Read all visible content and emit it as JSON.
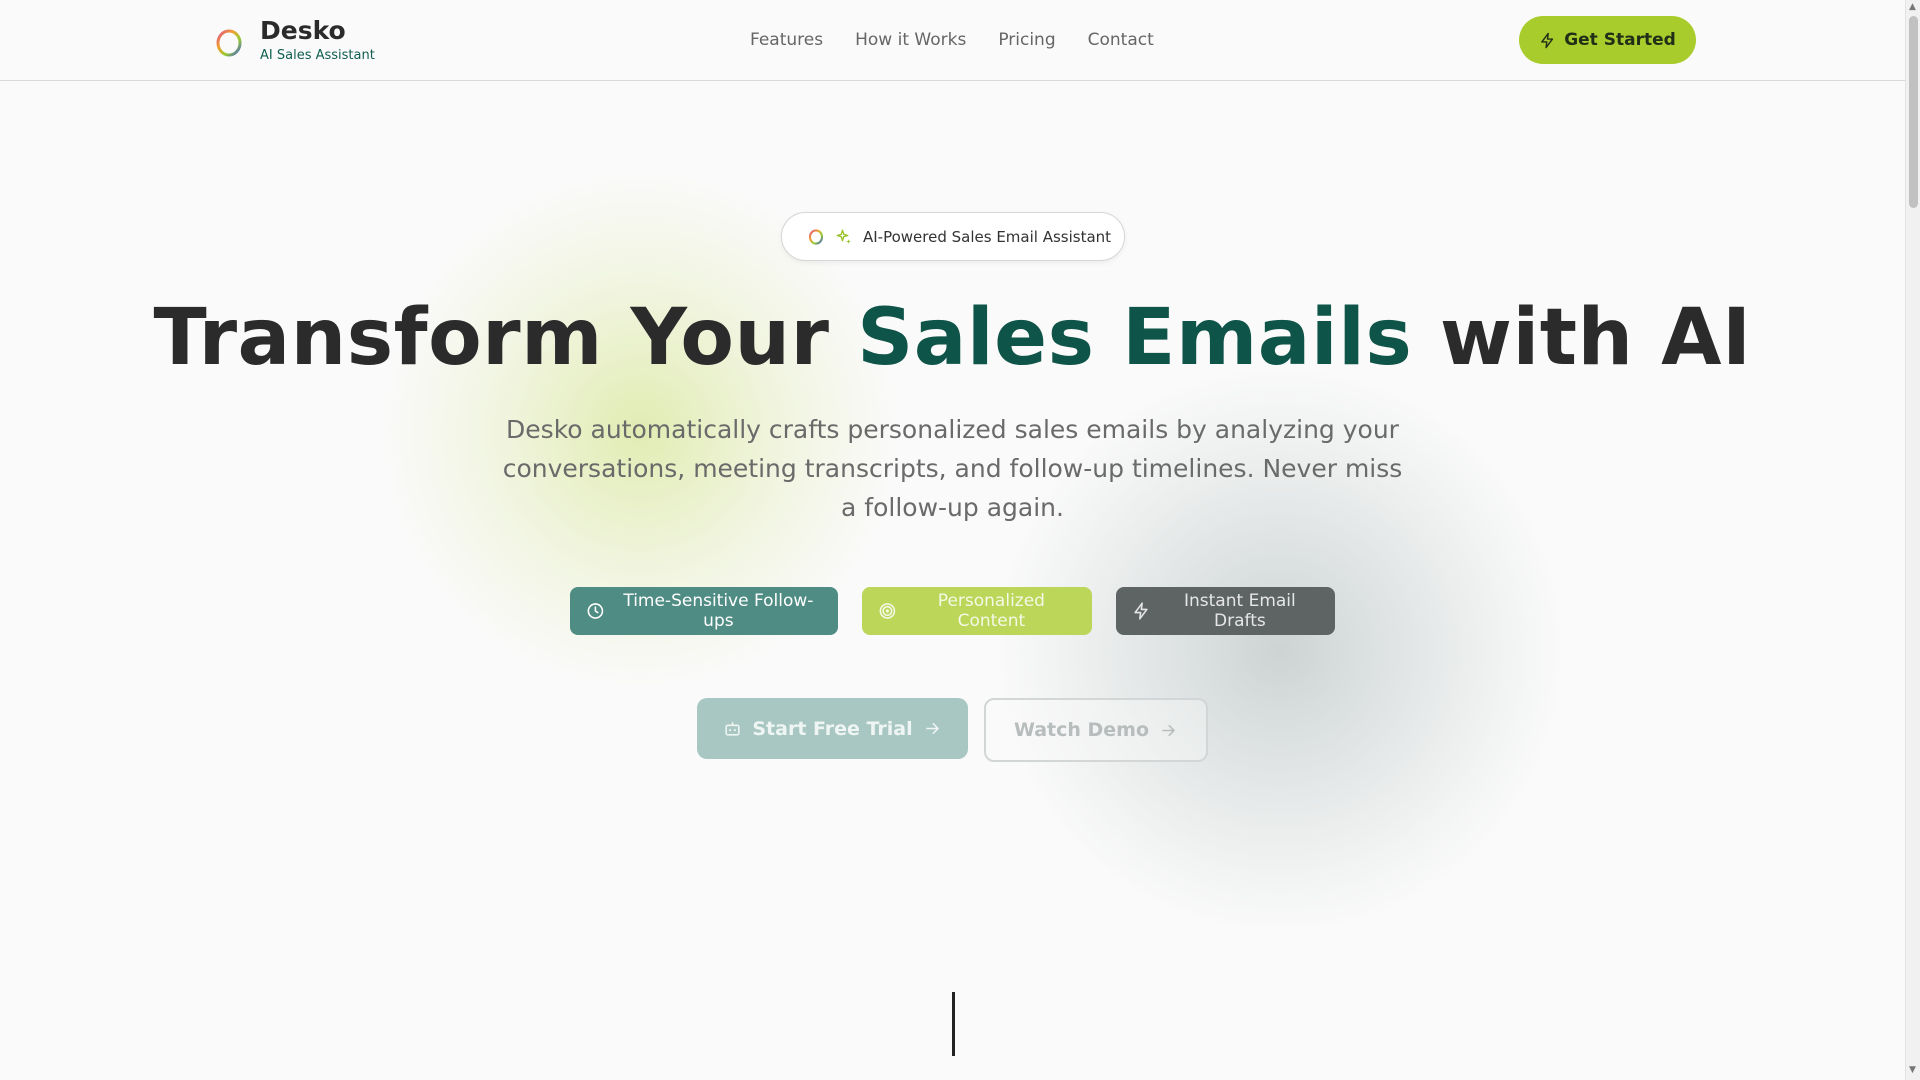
{
  "brand": {
    "name": "Desko",
    "tagline": "AI Sales Assistant"
  },
  "nav": {
    "items": [
      {
        "label": "Features"
      },
      {
        "label": "How it Works"
      },
      {
        "label": "Pricing"
      },
      {
        "label": "Contact"
      }
    ]
  },
  "header": {
    "cta_label": "Get Started"
  },
  "hero": {
    "pill_text": "AI-Powered Sales Email Assistant",
    "headline_part1": "Transform Your ",
    "headline_accent": "Sales Emails",
    "headline_part2": " with AI",
    "description": "Desko automatically crafts personalized sales emails by analyzing your conversations, meeting transcripts, and follow-up timelines. Never miss a follow-up again.",
    "chips": [
      {
        "label": "Time-Sensitive Follow-ups",
        "icon": "clock-icon"
      },
      {
        "label": "Personalized Content",
        "icon": "target-icon"
      },
      {
        "label": "Instant Email Drafts",
        "icon": "lightning-icon"
      }
    ],
    "primary_cta": "Start Free Trial",
    "secondary_cta": "Watch Demo"
  },
  "colors": {
    "accent_green": "#0f5448",
    "lime": "#a8cc2c",
    "teal_chip": "#4f8c84",
    "gray_chip": "#5e6464"
  }
}
